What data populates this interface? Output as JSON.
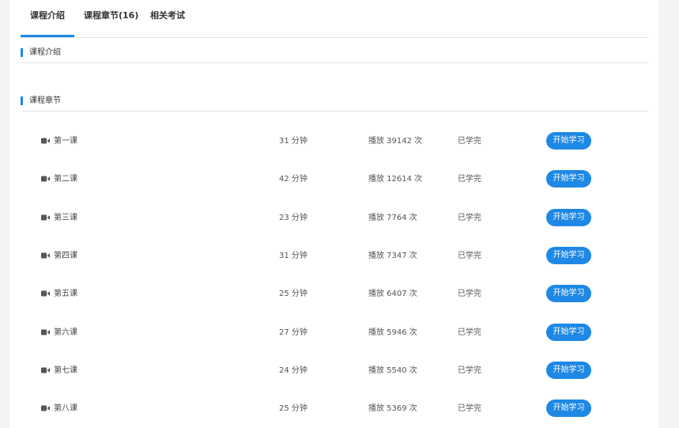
{
  "tabs": [
    {
      "label": "课程介绍",
      "active": true
    },
    {
      "label": "课程章节(16)",
      "active": false
    },
    {
      "label": "相关考试",
      "active": false
    }
  ],
  "sections": {
    "intro_title": "课程介绍",
    "chapters_title": "课程章节"
  },
  "colors": {
    "accent": "#1e88e5",
    "icon": "#555555"
  },
  "lessons": [
    {
      "name": "第一课",
      "duration": "31 分钟",
      "plays": "播放 39142 次",
      "status": "已学完",
      "button": "开始学习",
      "icon": "video-camera-icon"
    },
    {
      "name": "第二课",
      "duration": "42 分钟",
      "plays": "播放 12614 次",
      "status": "已学完",
      "button": "开始学习",
      "icon": "video-camera-icon"
    },
    {
      "name": "第三课",
      "duration": "23 分钟",
      "plays": "播放 7764 次",
      "status": "已学完",
      "button": "开始学习",
      "icon": "video-camera-icon"
    },
    {
      "name": "第四课",
      "duration": "31 分钟",
      "plays": "播放 7347 次",
      "status": "已学完",
      "button": "开始学习",
      "icon": "video-camera-icon"
    },
    {
      "name": "第五课",
      "duration": "25 分钟",
      "plays": "播放 6407 次",
      "status": "已学完",
      "button": "开始学习",
      "icon": "video-camera-icon"
    },
    {
      "name": "第六课",
      "duration": "27 分钟",
      "plays": "播放 5946 次",
      "status": "已学完",
      "button": "开始学习",
      "icon": "video-camera-icon"
    },
    {
      "name": "第七课",
      "duration": "24 分钟",
      "plays": "播放 5540 次",
      "status": "已学完",
      "button": "开始学习",
      "icon": "video-camera-icon"
    },
    {
      "name": "第八课",
      "duration": "25 分钟",
      "plays": "播放 5369 次",
      "status": "已学完",
      "button": "开始学习",
      "icon": "video-camera-icon"
    }
  ]
}
